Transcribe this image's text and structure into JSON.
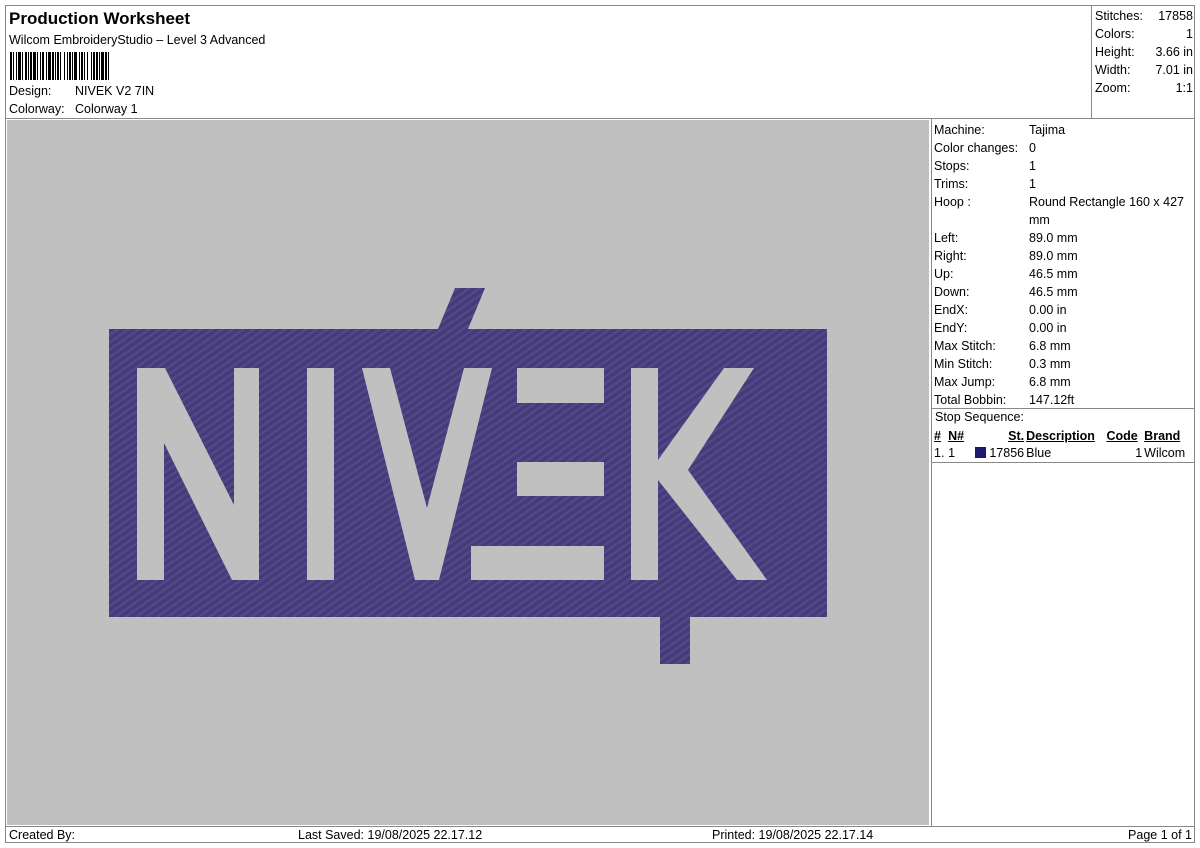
{
  "header": {
    "title": "Production Worksheet",
    "subtitle": "Wilcom EmbroideryStudio – Level 3 Advanced",
    "design_label": "Design:",
    "design_value": "NIVEK V2 7IN",
    "colorway_label": "Colorway:",
    "colorway_value": "Colorway 1"
  },
  "stats": [
    {
      "label": "Stitches:",
      "value": "17858"
    },
    {
      "label": "Colors:",
      "value": "1"
    },
    {
      "label": "Height:",
      "value": "3.66 in"
    },
    {
      "label": "Width:",
      "value": "7.01 in"
    },
    {
      "label": "Zoom:",
      "value": "1:1"
    }
  ],
  "design": {
    "text": "NIVEK",
    "thread_color": "#4a3f7e",
    "background_color": "#c0c0c0"
  },
  "info": [
    {
      "label": "Machine:",
      "value": "Tajima"
    },
    {
      "label": "Color changes:",
      "value": "0"
    },
    {
      "label": "Stops:",
      "value": "1"
    },
    {
      "label": "Trims:",
      "value": "1"
    },
    {
      "label": "Hoop :",
      "value": "Round Rectangle 160 x 427 mm"
    },
    {
      "label": "Left:",
      "value": "89.0 mm"
    },
    {
      "label": "Right:",
      "value": "89.0 mm"
    },
    {
      "label": "Up:",
      "value": "46.5 mm"
    },
    {
      "label": "Down:",
      "value": "46.5 mm"
    },
    {
      "label": "EndX:",
      "value": "0.00 in"
    },
    {
      "label": "EndY:",
      "value": "0.00 in"
    },
    {
      "label": "Max Stitch:",
      "value": "6.8 mm"
    },
    {
      "label": "Min Stitch:",
      "value": "0.3 mm"
    },
    {
      "label": "Max Jump:",
      "value": "6.8 mm"
    },
    {
      "label": "Total Bobbin:",
      "value": "147.12ft"
    }
  ],
  "stop_sequence": {
    "title": "Stop Sequence:",
    "headers": {
      "num": "#",
      "n": "N#",
      "st": "St.",
      "description": "Description",
      "code": "Code",
      "brand": "Brand"
    },
    "rows": [
      {
        "num": "1.",
        "n": "1",
        "color": "#1f1a6b",
        "st": "17856",
        "description": "Blue",
        "code": "1",
        "brand": "Wilcom"
      }
    ]
  },
  "footer": {
    "created_by": "Created By:",
    "last_saved": "Last Saved: 19/08/2025 22.17.12",
    "printed": "Printed: 19/08/2025 22.17.14",
    "page": "Page 1 of 1"
  }
}
